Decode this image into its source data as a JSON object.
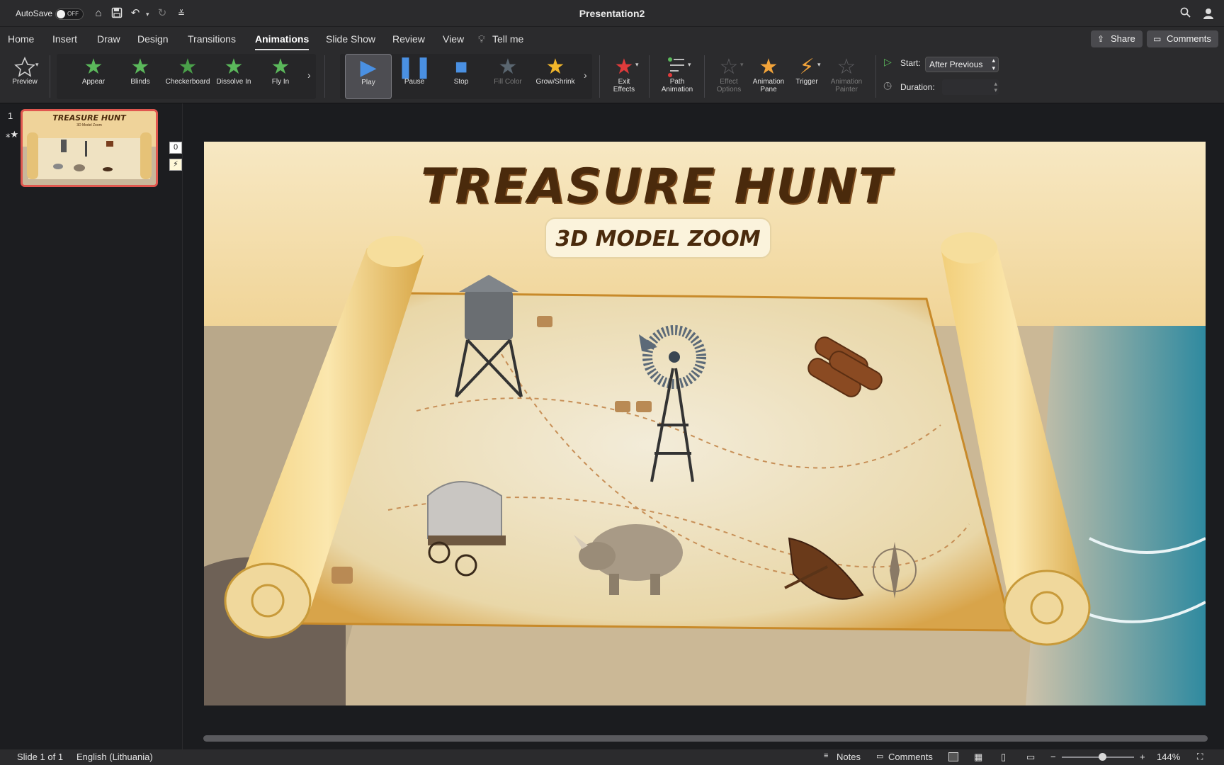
{
  "titlebar": {
    "autosave_label": "AutoSave",
    "autosave_state": "OFF",
    "document_title": "Presentation2"
  },
  "menu": {
    "tabs": [
      "Home",
      "Insert",
      "Draw",
      "Design",
      "Transitions",
      "Animations",
      "Slide Show",
      "Review",
      "View",
      "Tell me"
    ],
    "active_tab": "Animations",
    "share_label": "Share",
    "comments_label": "Comments"
  },
  "ribbon": {
    "preview_label": "Preview",
    "entrance_effects": [
      "Appear",
      "Blinds",
      "Checkerboard",
      "Dissolve In",
      "Fly In"
    ],
    "media_controls": [
      "Play",
      "Pause",
      "Stop",
      "Fill Color",
      "Grow/Shrink"
    ],
    "exit_effects_label": "Exit Effects",
    "path_animation_label": "Path Animation",
    "effect_options_label": "Effect Options",
    "animation_pane_label": "Animation Pane",
    "trigger_label": "Trigger",
    "animation_painter_label": "Animation Painter",
    "start_label": "Start:",
    "start_value": "After Previous",
    "duration_label": "Duration:",
    "duration_value": ""
  },
  "thumbnails": {
    "slide_number": "1",
    "thumb_title": "TREASURE HUNT",
    "thumb_subtitle": "3D Model Zoom"
  },
  "slide": {
    "animation_tag": "0",
    "title": "TREASURE HUNT",
    "subtitle": "3D MODEL ZOOM"
  },
  "statusbar": {
    "slide_info": "Slide 1 of 1",
    "language": "English (Lithuania)",
    "notes_label": "Notes",
    "comments_label": "Comments",
    "zoom": "144%"
  },
  "colors": {
    "accent_red": "#e0574f",
    "appear_green": "#5bb85b",
    "play_blue": "#4a90e2",
    "title_brown": "#4a2a0c"
  }
}
